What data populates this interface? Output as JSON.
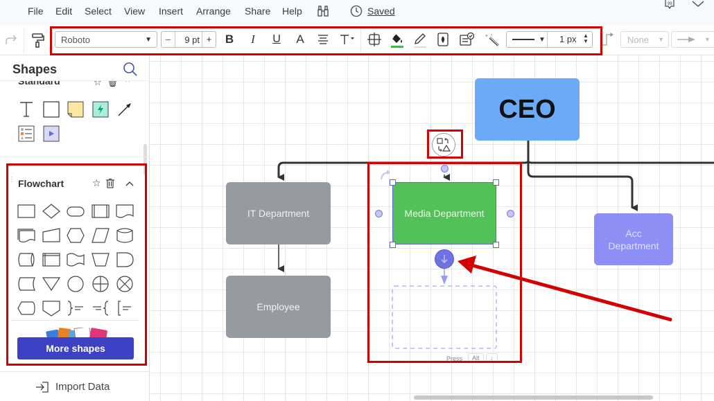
{
  "menubar": {
    "items": [
      "File",
      "Edit",
      "Select",
      "View",
      "Insert",
      "Arrange",
      "Share",
      "Help"
    ],
    "saved_label": "Saved"
  },
  "toolbar": {
    "font_family": "Roboto",
    "font_size": "9 pt",
    "font_size_decrease": "–",
    "font_size_increase": "+",
    "bold": "B",
    "italic": "I",
    "underline": "U",
    "text_color": "A",
    "line_width": "1 px",
    "line_start": "None",
    "fill_color_indicator": "#4caf50"
  },
  "sidebar": {
    "title": "Shapes",
    "standard_label": "Standard",
    "flowchart_label": "Flowchart",
    "more_shapes_label": "More shapes",
    "import_data_label": "Import Data"
  },
  "canvas": {
    "nodes": {
      "ceo": "CEO",
      "it": "IT Department",
      "employee": "Employee",
      "media": "Media Department",
      "acc": "Acc Department"
    },
    "colors": {
      "ceo": "#6aaaf7",
      "gray": "#959aa3",
      "media": "#53c15a",
      "acc": "#8e8ef7",
      "annotation": "#d40000"
    },
    "hint_press": "Press",
    "hint_key1": "Alt",
    "hint_key2": "↓"
  }
}
